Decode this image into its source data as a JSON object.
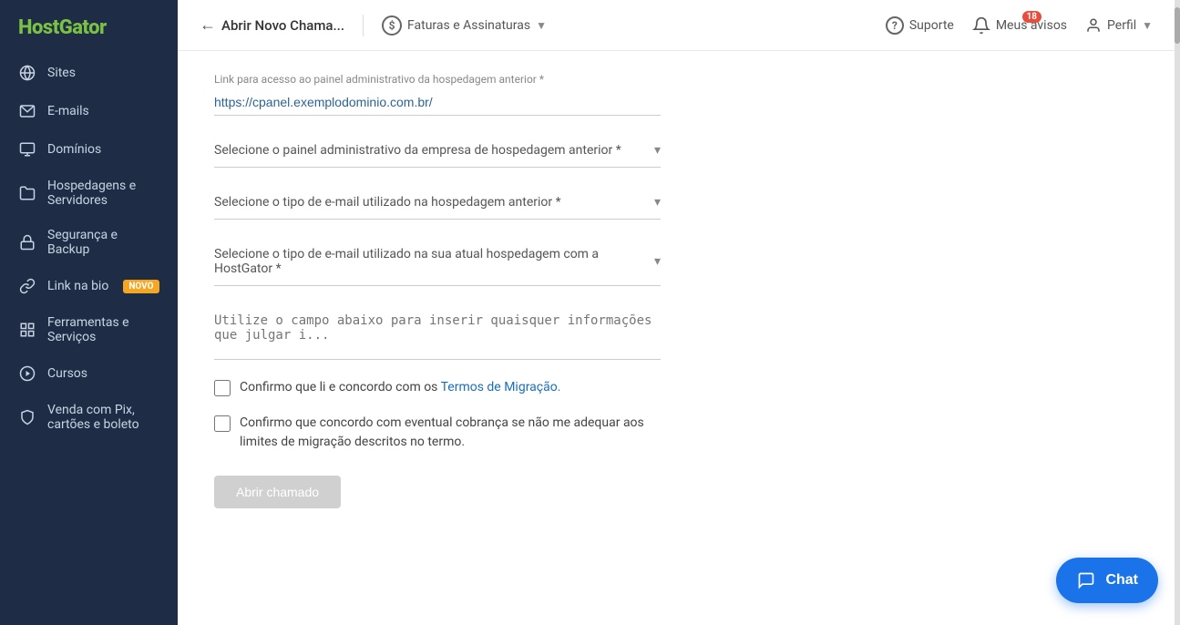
{
  "app": {
    "logo_text1": "Host",
    "logo_text2": "Gator"
  },
  "sidebar": {
    "items": [
      {
        "id": "sites",
        "label": "Sites",
        "icon": "globe"
      },
      {
        "id": "emails",
        "label": "E-mails",
        "icon": "mail"
      },
      {
        "id": "dominios",
        "label": "Domínios",
        "icon": "monitor"
      },
      {
        "id": "hospedagens",
        "label": "Hospedagens e Servidores",
        "icon": "folder"
      },
      {
        "id": "seguranca",
        "label": "Segurança e Backup",
        "icon": "lock"
      },
      {
        "id": "link-bio",
        "label": "Link na bio",
        "icon": "link",
        "badge": "NOVO"
      },
      {
        "id": "ferramentas",
        "label": "Ferramentas e Serviços",
        "icon": "grid"
      },
      {
        "id": "cursos",
        "label": "Cursos",
        "icon": "play"
      },
      {
        "id": "venda",
        "label": "Venda com Pix, cartões e boleto",
        "icon": "shield"
      }
    ]
  },
  "topbar": {
    "back_label": "Abrir Novo Chama...",
    "section_label": "Faturas e Assinaturas",
    "support_label": "Suporte",
    "notifications_label": "Meus avisos",
    "notifications_count": "18",
    "profile_label": "Perfil"
  },
  "form": {
    "link_label": "Link para acesso ao painel administrativo da hospedagem anterior *",
    "link_value": "https://cpanel.exemplodominio.com.br/",
    "select1_placeholder": "Selecione o painel administrativo da empresa de hospedagem anterior *",
    "select2_placeholder": "Selecione o tipo de e-mail utilizado na hospedagem anterior *",
    "select3_placeholder": "Selecione o tipo de e-mail utilizado na sua atual hospedagem com a HostGator *",
    "textarea_placeholder": "Utilize o campo abaixo para inserir quaisquer informações que julgar i...",
    "checkbox1_text": "Confirmo que li e concordo com os Termos de Migração.",
    "checkbox2_text": "Confirmo que concordo com eventual cobrança se não me adequar aos limites de migração descritos no termo.",
    "submit_label": "Abrir chamado"
  },
  "chat": {
    "label": "Chat",
    "icon": "chat-bubble"
  }
}
